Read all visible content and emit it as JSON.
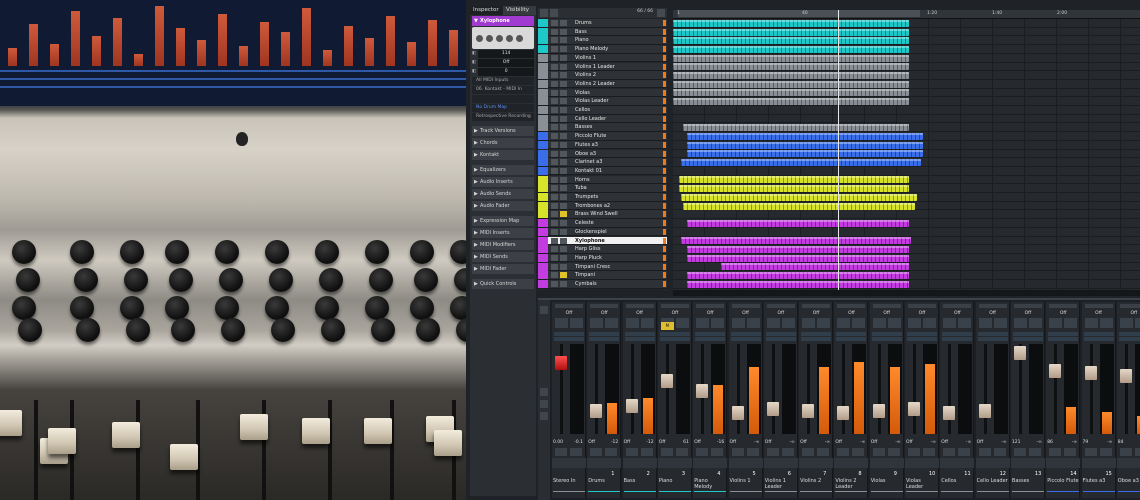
{
  "inspector": {
    "tabs": [
      "Inspector",
      "Visibility"
    ],
    "track_name": "Xylophone",
    "params": [
      {
        "label": "",
        "value": "114"
      },
      {
        "label": "",
        "value": "Off"
      },
      {
        "label": "",
        "value": "0"
      }
    ],
    "routing": [
      "All MIDI Inputs",
      "06. Kontakt - MIDI In",
      "",
      "No Drum Map",
      "Retrospective Recording"
    ],
    "sections": [
      "Track Versions",
      "Chords",
      "Kontakt",
      "Equalizers",
      "Audio Inserts",
      "Audio Sends",
      "Audio Fader",
      "Expression Map",
      "MIDI Inserts",
      "MIDI Modifiers",
      "MIDI Sends",
      "MIDI Fader",
      "Quick Controls"
    ]
  },
  "tracklist": {
    "count": "66 / 66",
    "tracks": [
      {
        "name": "Drums",
        "color": "#1ec8c8"
      },
      {
        "name": "Bass",
        "color": "#1ec8c8"
      },
      {
        "name": "Piano",
        "color": "#1ec8c8"
      },
      {
        "name": "Piano Melody",
        "color": "#1ec8c8"
      },
      {
        "name": "Violins 1",
        "color": "#8a8f95"
      },
      {
        "name": "Violins 1 Leader",
        "color": "#8a8f95"
      },
      {
        "name": "Violins 2",
        "color": "#8a8f95"
      },
      {
        "name": "Violins 2 Leader",
        "color": "#8a8f95"
      },
      {
        "name": "Violas",
        "color": "#8a8f95"
      },
      {
        "name": "Violas Leader",
        "color": "#8a8f95"
      },
      {
        "name": "Cellos",
        "color": "#8a8f95"
      },
      {
        "name": "Cello Leader",
        "color": "#8a8f95"
      },
      {
        "name": "Basses",
        "color": "#8a8f95"
      },
      {
        "name": "Piccolo Flute",
        "color": "#3a6de8"
      },
      {
        "name": "Flutes a3",
        "color": "#3a6de8"
      },
      {
        "name": "Oboe a3",
        "color": "#3a6de8"
      },
      {
        "name": "Clarinet a3",
        "color": "#3a6de8"
      },
      {
        "name": "Kontakt 01",
        "color": "#3a6de8"
      },
      {
        "name": "Horns",
        "color": "#d6e32a"
      },
      {
        "name": "Tuba",
        "color": "#d6e32a"
      },
      {
        "name": "Trumpets",
        "color": "#d6e32a"
      },
      {
        "name": "Trombones a2",
        "color": "#d6e32a"
      },
      {
        "name": "Brass Wind Swell",
        "color": "#d6e32a"
      },
      {
        "name": "Celeste",
        "color": "#c23ce0"
      },
      {
        "name": "Glockenspiel",
        "color": "#c23ce0"
      },
      {
        "name": "Xylophone",
        "color": "#c23ce0"
      },
      {
        "name": "Harp Gliss",
        "color": "#c23ce0"
      },
      {
        "name": "Harp Pluck",
        "color": "#c23ce0"
      },
      {
        "name": "Timpani Cresc",
        "color": "#c23ce0"
      },
      {
        "name": "Timpani",
        "color": "#c23ce0"
      },
      {
        "name": "Cymbals",
        "color": "#c23ce0"
      }
    ]
  },
  "ruler": {
    "ticks": [
      "1",
      "40",
      "1:20",
      "1:40",
      "2:00"
    ]
  },
  "mixer": {
    "strips": [
      {
        "num": "",
        "name": "Stereo In",
        "vol": "0.00",
        "peak": "-0.1",
        "color": "#8a8f95"
      },
      {
        "num": "1",
        "name": "Drums",
        "vol": "Off",
        "peak": "-12",
        "color": "#1ec8c8"
      },
      {
        "num": "2",
        "name": "Bass",
        "vol": "Off",
        "peak": "-12",
        "color": "#1ec8c8"
      },
      {
        "num": "3",
        "name": "Piano",
        "vol": "Off",
        "peak": "61",
        "color": "#1ec8c8"
      },
      {
        "num": "4",
        "name": "Piano Melody",
        "vol": "Off",
        "peak": "-16",
        "color": "#1ec8c8"
      },
      {
        "num": "5",
        "name": "Violins 1",
        "vol": "Off",
        "peak": "-∞",
        "color": "#8a8f95"
      },
      {
        "num": "6",
        "name": "Violins 1 Leader",
        "vol": "Off",
        "peak": "-∞",
        "color": "#8a8f95"
      },
      {
        "num": "7",
        "name": "Violins 2",
        "vol": "Off",
        "peak": "-∞",
        "color": "#8a8f95"
      },
      {
        "num": "8",
        "name": "Violins 2 Leader",
        "vol": "Off",
        "peak": "-∞",
        "color": "#8a8f95"
      },
      {
        "num": "9",
        "name": "Violas",
        "vol": "Off",
        "peak": "-∞",
        "color": "#8a8f95"
      },
      {
        "num": "10",
        "name": "Violas Leader",
        "vol": "Off",
        "peak": "-∞",
        "color": "#8a8f95"
      },
      {
        "num": "11",
        "name": "Cellos",
        "vol": "Off",
        "peak": "-∞",
        "color": "#8a8f95"
      },
      {
        "num": "12",
        "name": "Cello Leader",
        "vol": "Off",
        "peak": "-∞",
        "color": "#8a8f95"
      },
      {
        "num": "13",
        "name": "Basses",
        "vol": "121",
        "peak": "-∞",
        "color": "#8a8f95"
      },
      {
        "num": "14",
        "name": "Piccolo Flute",
        "vol": "86",
        "peak": "-∞",
        "color": "#3a6de8"
      },
      {
        "num": "15",
        "name": "Flutes a3",
        "vol": "79",
        "peak": "-∞",
        "color": "#3a6de8"
      },
      {
        "num": "16",
        "name": "Oboe a3",
        "vol": "84",
        "peak": "-∞",
        "color": "#3a6de8"
      }
    ],
    "off_label": "Off"
  }
}
